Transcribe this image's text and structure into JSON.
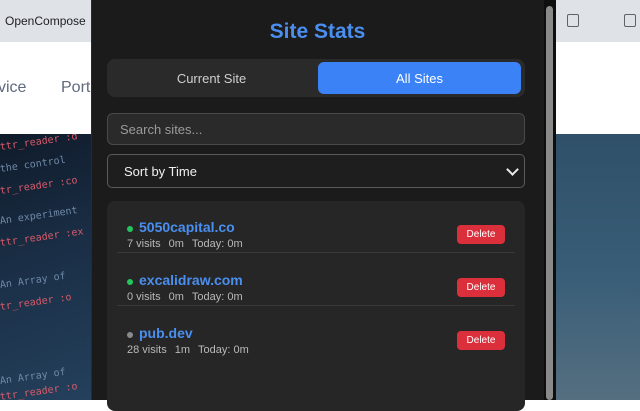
{
  "browser": {
    "tab_title": "OpenCompose"
  },
  "background_page": {
    "nav_items": [
      "vice",
      "Port"
    ],
    "code_lines": [
      "ttr_reader :d",
      "the control",
      "tr_reader :co",
      "An experiment",
      "ttr_reader :ex",
      "An Array of",
      "tr_reader :o",
      "An Array of",
      "ttr_reader :o"
    ]
  },
  "popup": {
    "title": "Site Stats",
    "tabs": [
      {
        "label": "Current Site",
        "active": false
      },
      {
        "label": "All Sites",
        "active": true
      }
    ],
    "search": {
      "placeholder": "Search sites...",
      "value": ""
    },
    "sort": {
      "selected": "Sort by Time"
    },
    "sites": [
      {
        "domain": "5050capital.co",
        "visits": "7 visits",
        "time": "0m",
        "today": "Today: 0m",
        "status_color": "#22c55e",
        "delete_label": "Delete"
      },
      {
        "domain": "excalidraw.com",
        "visits": "0 visits",
        "time": "0m",
        "today": "Today: 0m",
        "status_color": "#22c55e",
        "delete_label": "Delete"
      },
      {
        "domain": "pub.dev",
        "visits": "28 visits",
        "time": "1m",
        "today": "Today: 0m",
        "status_color": "#8a8a8a",
        "delete_label": "Delete"
      }
    ]
  },
  "colors": {
    "accent": "#3b82f6",
    "link": "#4a8ff0",
    "danger": "#dc2f3c",
    "popup_bg": "#1b1b1b"
  }
}
